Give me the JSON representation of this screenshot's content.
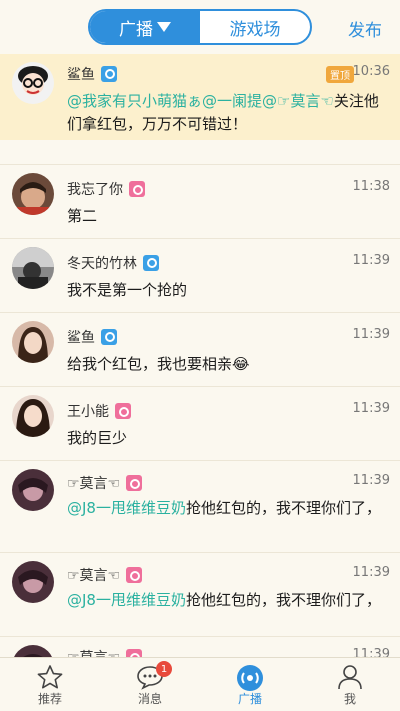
{
  "header": {
    "tabs": [
      {
        "label": "广播",
        "active": true
      },
      {
        "label": "游戏场",
        "active": false
      }
    ],
    "publish_label": "发布"
  },
  "feed": {
    "pinned": {
      "name": "鲨鱼",
      "gender": "male",
      "tag": "置顶",
      "time": "10:36",
      "mention": "@我家有只小萌猫ぁ@一阑提@☞莫言☜",
      "text": "关注他们拿红包，万万不可错过！"
    },
    "items": [
      {
        "name": "我忘了你",
        "gender": "female",
        "time": "11:38",
        "mention": "",
        "text": "第二"
      },
      {
        "name": "冬天的竹林",
        "gender": "male",
        "time": "11:39",
        "mention": "",
        "text": "我不是第一个抢的"
      },
      {
        "name": "鲨鱼",
        "gender": "male",
        "time": "11:39",
        "mention": "",
        "text": "给我个红包，我也要相亲😂"
      },
      {
        "name": "王小能",
        "gender": "female",
        "time": "11:39",
        "mention": "",
        "text": "我的巨少"
      },
      {
        "name": "☞莫言☜",
        "gender": "female",
        "time": "11:39",
        "mention": "@J8一甩维维豆奶",
        "text": "抢他红包的，我不理你们了，"
      },
      {
        "name": "☞莫言☜",
        "gender": "female",
        "time": "11:39",
        "mention": "@J8一甩维维豆奶",
        "text": "抢他红包的，我不理你们了，"
      },
      {
        "name": "☞莫言☜",
        "gender": "female",
        "time": "11:39",
        "mention": "",
        "text": ""
      }
    ]
  },
  "bottom_nav": {
    "items": [
      {
        "label": "推荐",
        "icon": "star-icon",
        "active": false
      },
      {
        "label": "消息",
        "icon": "chat-icon",
        "active": false,
        "badge": "1"
      },
      {
        "label": "广播",
        "icon": "broadcast-icon",
        "active": true
      },
      {
        "label": "我",
        "icon": "person-icon",
        "active": false
      }
    ]
  },
  "colors": {
    "accent": "#2f8fdc",
    "mention": "#2bb1a0",
    "pinned_bg": "#fcf0cd",
    "male_badge": "#3aa0e6",
    "female_badge": "#ef6f9b",
    "background": "#fbf8ef"
  }
}
